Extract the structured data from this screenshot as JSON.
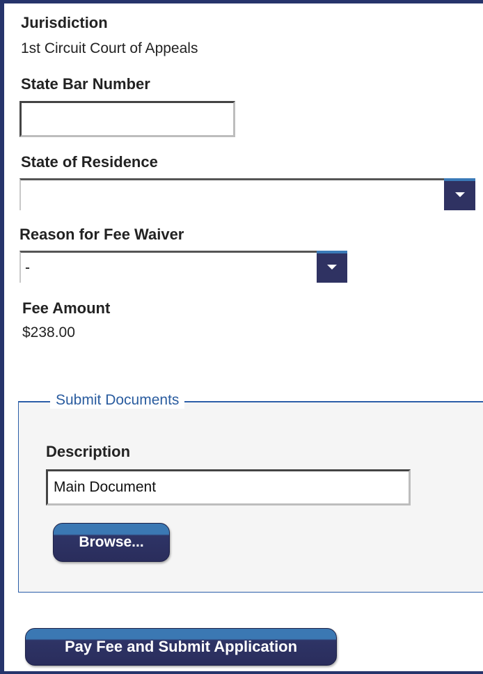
{
  "jurisdiction": {
    "label": "Jurisdiction",
    "value": "1st Circuit Court of Appeals"
  },
  "state_bar": {
    "label": "State Bar Number",
    "value": ""
  },
  "state_residence": {
    "label": "State of Residence",
    "selected": ""
  },
  "fee_waiver": {
    "label": "Reason for Fee Waiver",
    "selected": "-"
  },
  "fee_amount": {
    "label": "Fee Amount",
    "value": "$238.00"
  },
  "submit_documents": {
    "legend": "Submit Documents",
    "description_label": "Description",
    "description_value": "Main Document",
    "browse_label": "Browse..."
  },
  "submit_button_label": "Pay Fee and Submit Application",
  "colors": {
    "border": "#26346b",
    "accent_blue": "#2b5ea8",
    "button_dark": "#2a2d5c",
    "button_light": "#3b78b3"
  }
}
